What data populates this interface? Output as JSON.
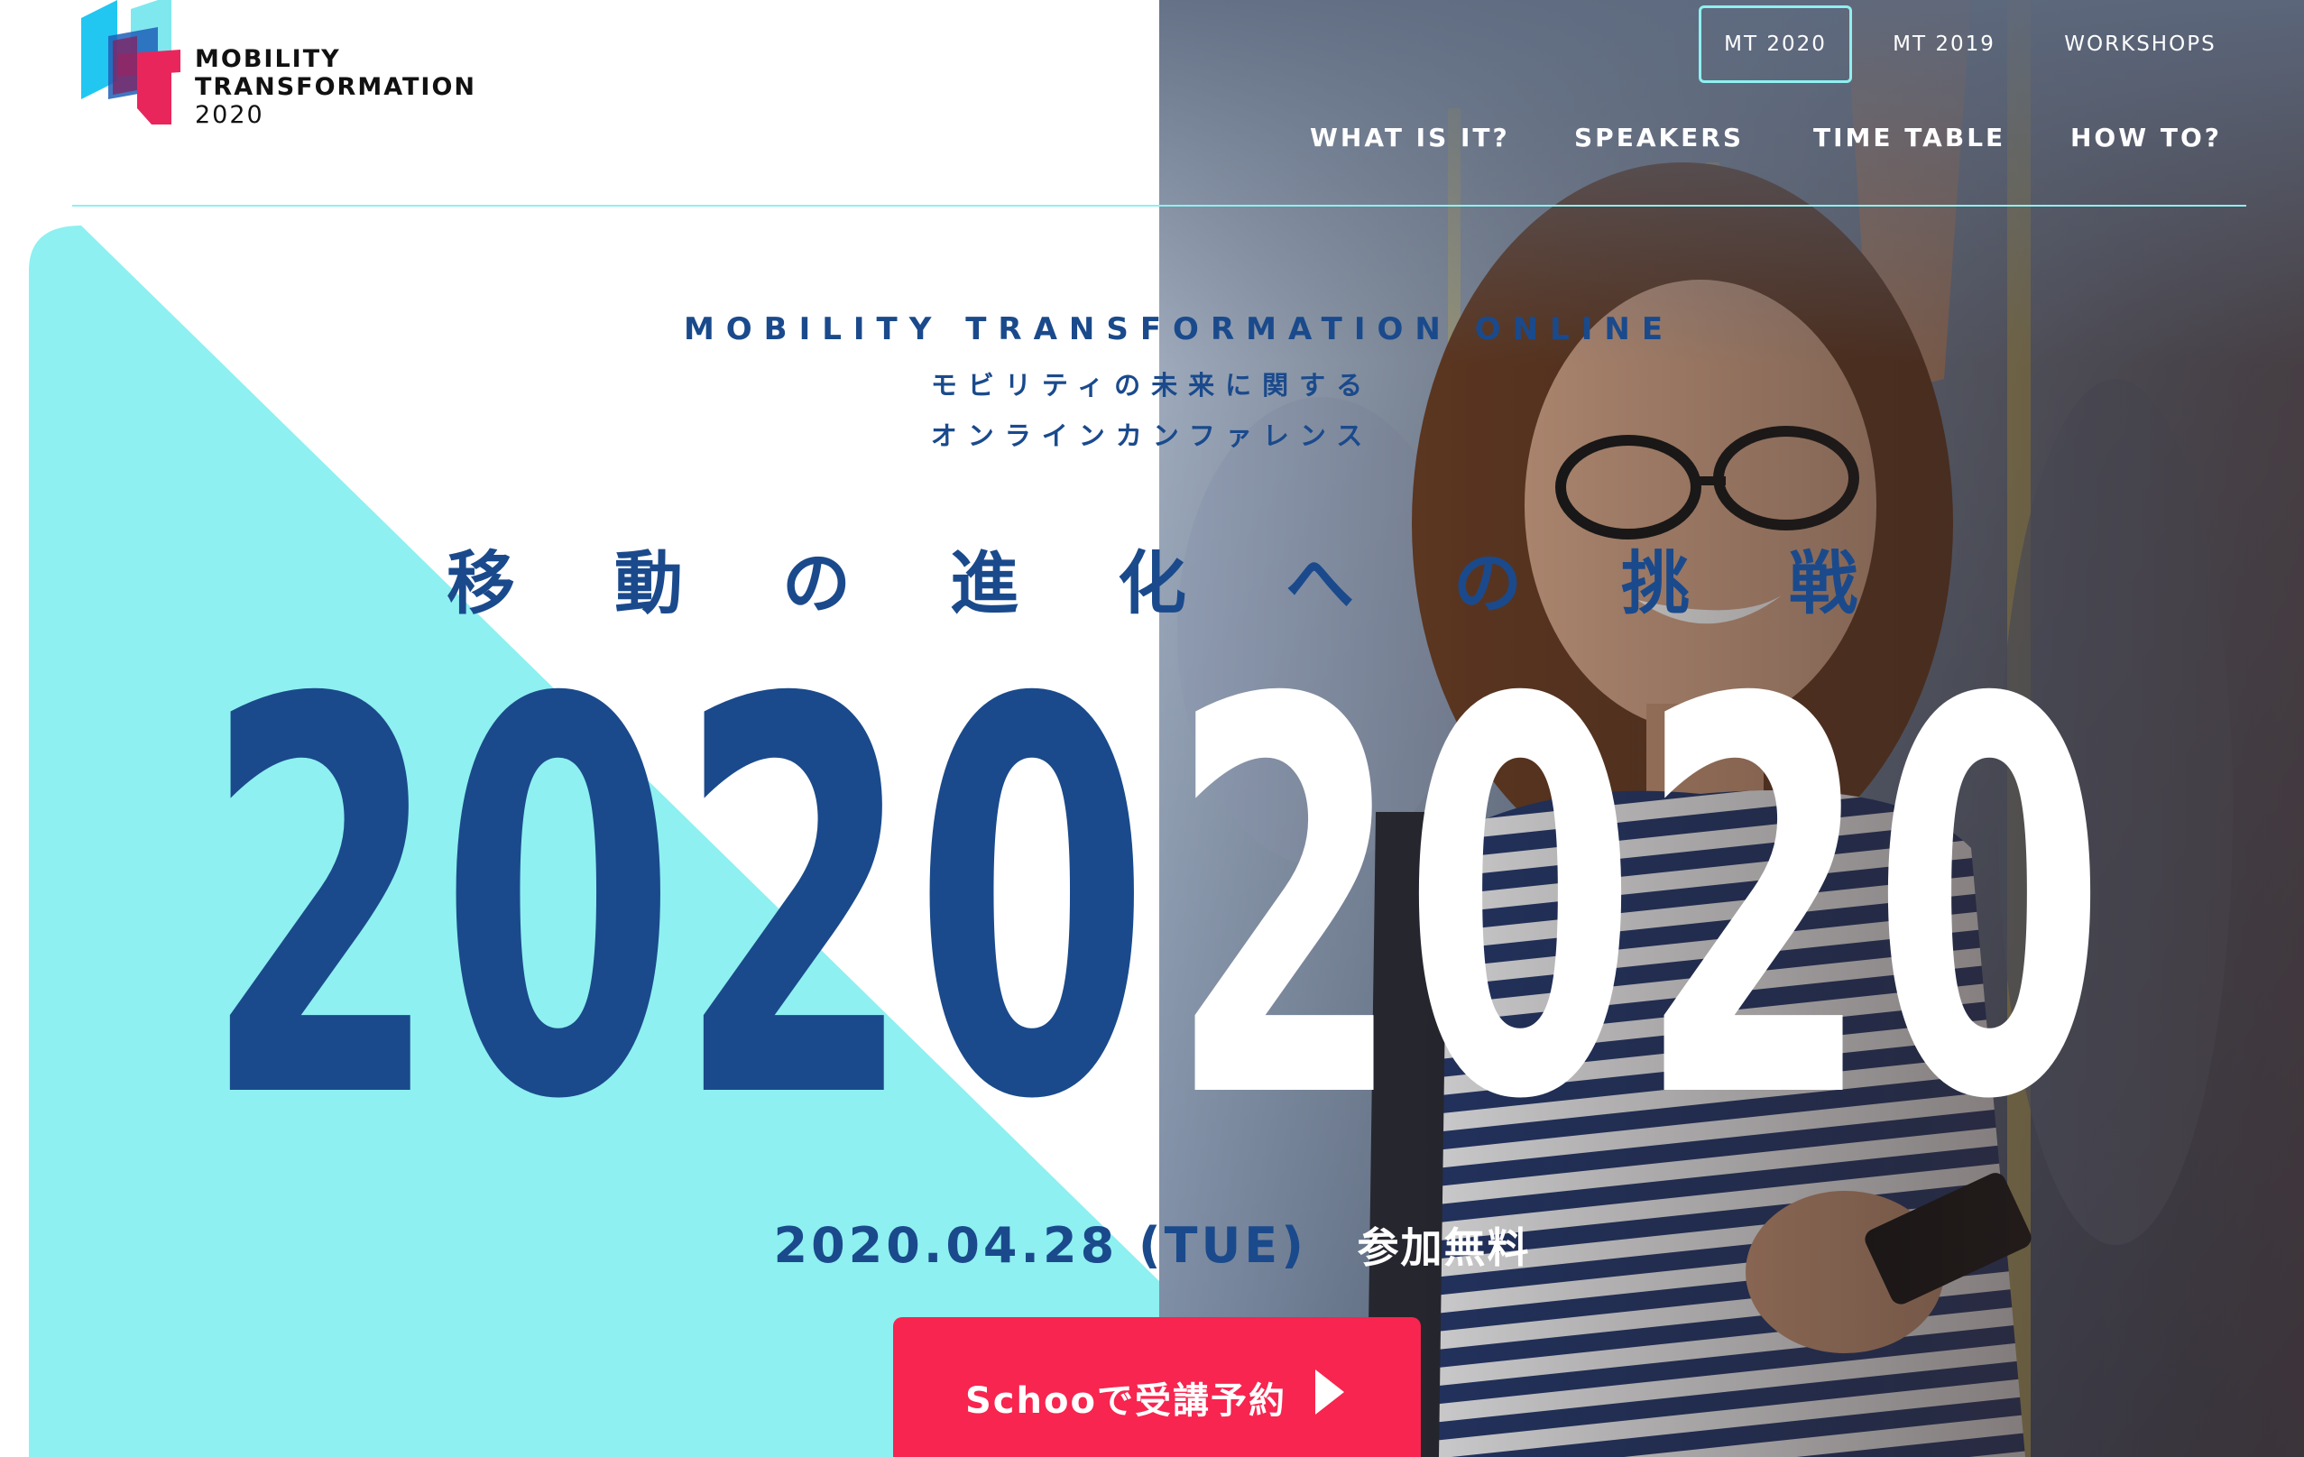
{
  "colors": {
    "navy": "#1a4a8c",
    "cyan": "#8ef0f0",
    "cta_red": "#f7254f",
    "white": "#ffffff"
  },
  "logo": {
    "line1": "MOBILITY",
    "line2": "TRANSFORMATION",
    "line3": "2020"
  },
  "nav": {
    "top": [
      {
        "label": "MT 2020",
        "active": true
      },
      {
        "label": "MT 2019",
        "active": false
      },
      {
        "label": "WORKSHOPS",
        "active": false
      }
    ],
    "main": [
      {
        "label": "WHAT IS IT?"
      },
      {
        "label": "SPEAKERS"
      },
      {
        "label": "TIME TABLE"
      },
      {
        "label": "HOW TO?"
      }
    ]
  },
  "hero": {
    "tagline_en": "MOBILITY TRANSFORMATION ONLINE",
    "tagline_jp_line1": "モビリティの未来に関する",
    "tagline_jp_line2": "オンラインカンファレンス",
    "headline": "移動の進化への挑戦",
    "year": "2020",
    "date": "2020.04.28 (TUE)",
    "free_label": "参加無料",
    "cta_label": "Schooで受講予約"
  },
  "icons": {
    "logo_mark": "mt-logo-mark-icon",
    "cta_arrow": "play-arrow-icon"
  }
}
